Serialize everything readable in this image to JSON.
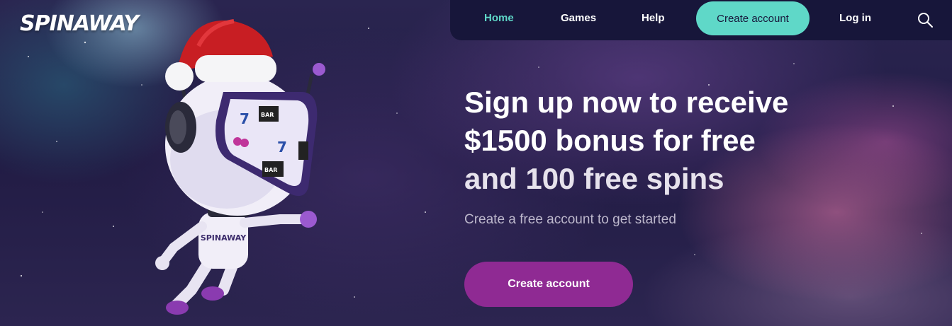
{
  "brand": {
    "logo_text": "SPINAWAY",
    "mascot_logo_text": "SPINAWAY"
  },
  "nav": {
    "items": [
      {
        "label": "Home",
        "active": true
      },
      {
        "label": "Games",
        "active": false
      },
      {
        "label": "Help",
        "active": false
      }
    ],
    "create_account_label": "Create account",
    "login_label": "Log in",
    "search_icon": "search-icon"
  },
  "hero": {
    "headline_line1": "Sign up now to receive",
    "headline_line2": "$1500 bonus for free",
    "headline_line3": "and 100 free spins",
    "subtitle": "Create a free account to get started",
    "cta_label": "Create account"
  },
  "colors": {
    "nav_bg": "#17163a",
    "accent_teal": "#5fd8c8",
    "cta_purple": "#8f2a93"
  }
}
